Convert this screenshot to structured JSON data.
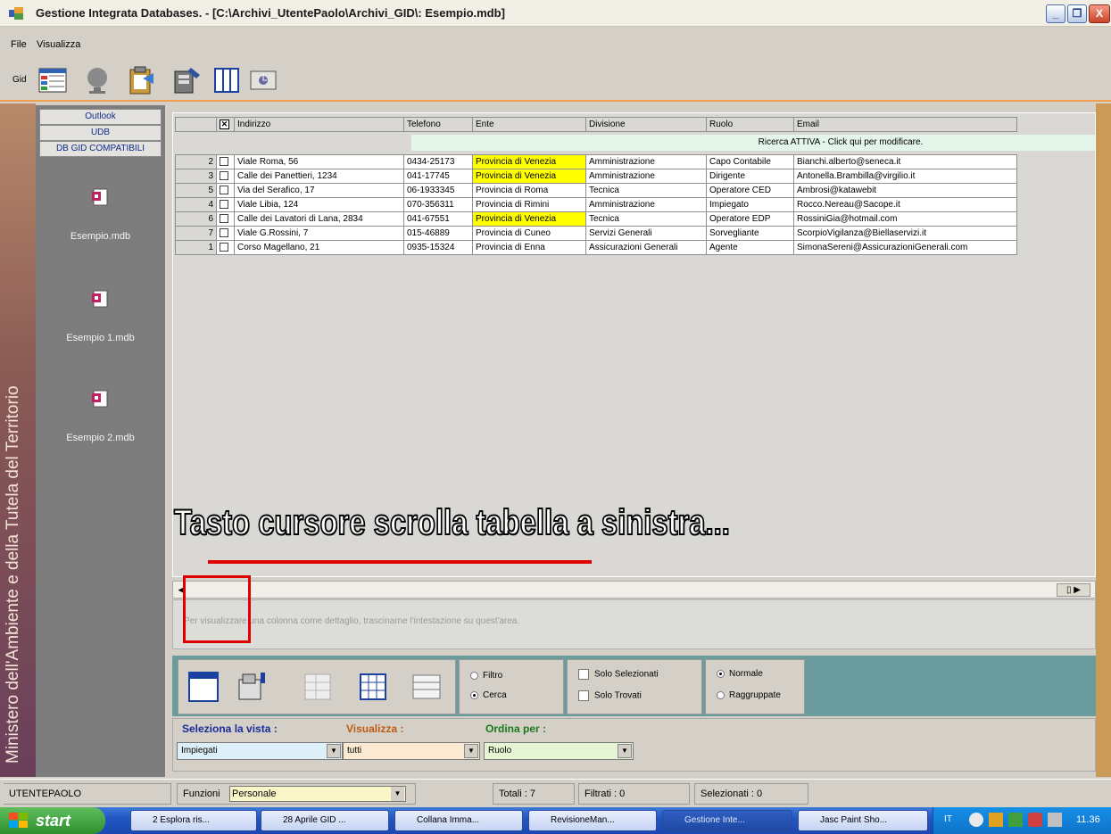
{
  "window": {
    "title": "Gestione Integrata Databases. - [C:\\Archivi_UtentePaolo\\Archivi_GID\\: Esempio.mdb]",
    "minimize": "_",
    "maximize": "❐",
    "close": "X"
  },
  "menu": {
    "file": "File",
    "view": "Visualizza"
  },
  "toolbar": {
    "gid_label": "Gid"
  },
  "side_banner": "Ministero dell'Ambiente e della Tutela del Territorio",
  "sidebar": {
    "tabs": [
      "Outlook",
      "UDB",
      "DB GID COMPATIBILI"
    ],
    "items": [
      "Esempio.mdb",
      "Esempio 1.mdb",
      "Esempio 2.mdb"
    ]
  },
  "grid": {
    "columns": [
      "Indirizzo",
      "Telefono",
      "Ente",
      "Divisione",
      "Ruolo",
      "Email"
    ],
    "filter_row": "Ricerca ATTIVA - Click qui per modificare.",
    "rows": [
      {
        "n": "2",
        "addr": "Viale Roma, 56",
        "tel": "0434-25173",
        "ente": "Provincia di Venezia",
        "div": "Amministrazione",
        "ruolo": "Capo Contabile",
        "email": "Bianchi.alberto@seneca.it",
        "hl": true
      },
      {
        "n": "3",
        "addr": "Calle dei Panettieri, 1234",
        "tel": "041-17745",
        "ente": "Provincia di Venezia",
        "div": "Amministrazione",
        "ruolo": "Dirigente",
        "email": "Antonella.Brambilla@virgilio.it",
        "hl": true
      },
      {
        "n": "5",
        "addr": "Via del Serafico, 17",
        "tel": "06-1933345",
        "ente": "Provincia di Roma",
        "div": "Tecnica",
        "ruolo": "Operatore CED",
        "email": "Ambrosi@katawebit",
        "hl": false
      },
      {
        "n": "4",
        "addr": "Viale Libia, 124",
        "tel": "070-356311",
        "ente": "Provincia di Rimini",
        "div": "Amministrazione",
        "ruolo": "Impiegato",
        "email": "Rocco.Nereau@Sacope.it",
        "hl": false
      },
      {
        "n": "6",
        "addr": "Calle dei Lavatori di Lana, 2834",
        "tel": "041-67551",
        "ente": "Provincia di Venezia",
        "div": "Tecnica",
        "ruolo": "Operatore EDP",
        "email": "RossiniGia@hotmail.com",
        "hl": true
      },
      {
        "n": "7",
        "addr": "Viale G.Rossini, 7",
        "tel": "015-46889",
        "ente": "Provincia di Cuneo",
        "div": "Servizi Generali",
        "ruolo": "Sorvegliante",
        "email": "ScorpioVigilanza@Biellaservizi.it",
        "hl": false
      },
      {
        "n": "1",
        "addr": "Corso Magellano, 21",
        "tel": "0935-15324",
        "ente": "Provincia di Enna",
        "div": "Assicurazioni Generali",
        "ruolo": "Agente",
        "email": "SimonaSereni@AssicurazioniGenerali.com",
        "hl": false
      }
    ]
  },
  "annotation": "Tasto cursore scrolla tabella a sinistra...",
  "hint": "Per visualizzare una colonna come dettaglio, trascinarne l'intestazione su quest'area.",
  "options": {
    "filtro": "Filtro",
    "cerca": "Cerca",
    "solo_selezionati": "Solo Selezionati",
    "solo_trovati": "Solo Trovati",
    "normale": "Normale",
    "raggruppate": "Raggruppate"
  },
  "view": {
    "seleziona_label": "Seleziona la vista :",
    "seleziona_value": "Impiegati",
    "visualizza_label": "Visualizza :",
    "visualizza_value": "tutti",
    "ordina_label": "Ordina per :",
    "ordina_value": "Ruolo"
  },
  "status": {
    "user": "UTENTEPAOLO",
    "funzioni_label": "Funzioni",
    "funzioni_value": "Personale",
    "totali": "Totali : 7",
    "filtrati": "Filtrati : 0",
    "selezionati": "Selezionati : 0"
  },
  "taskbar": {
    "start": "start",
    "tasks": [
      "2 Esplora ris...",
      "28 Aprile GID ...",
      "Collana Imma...",
      "RevisioneMan...",
      "Gestione Inte...",
      "Jasc Paint Sho..."
    ],
    "clock": "11.36"
  },
  "colors": {
    "accent_orange": "#f0a050",
    "panel_teal": "#6a9c9e",
    "highlight_yellow": "#ffff00",
    "annotation_red": "#e00000"
  }
}
